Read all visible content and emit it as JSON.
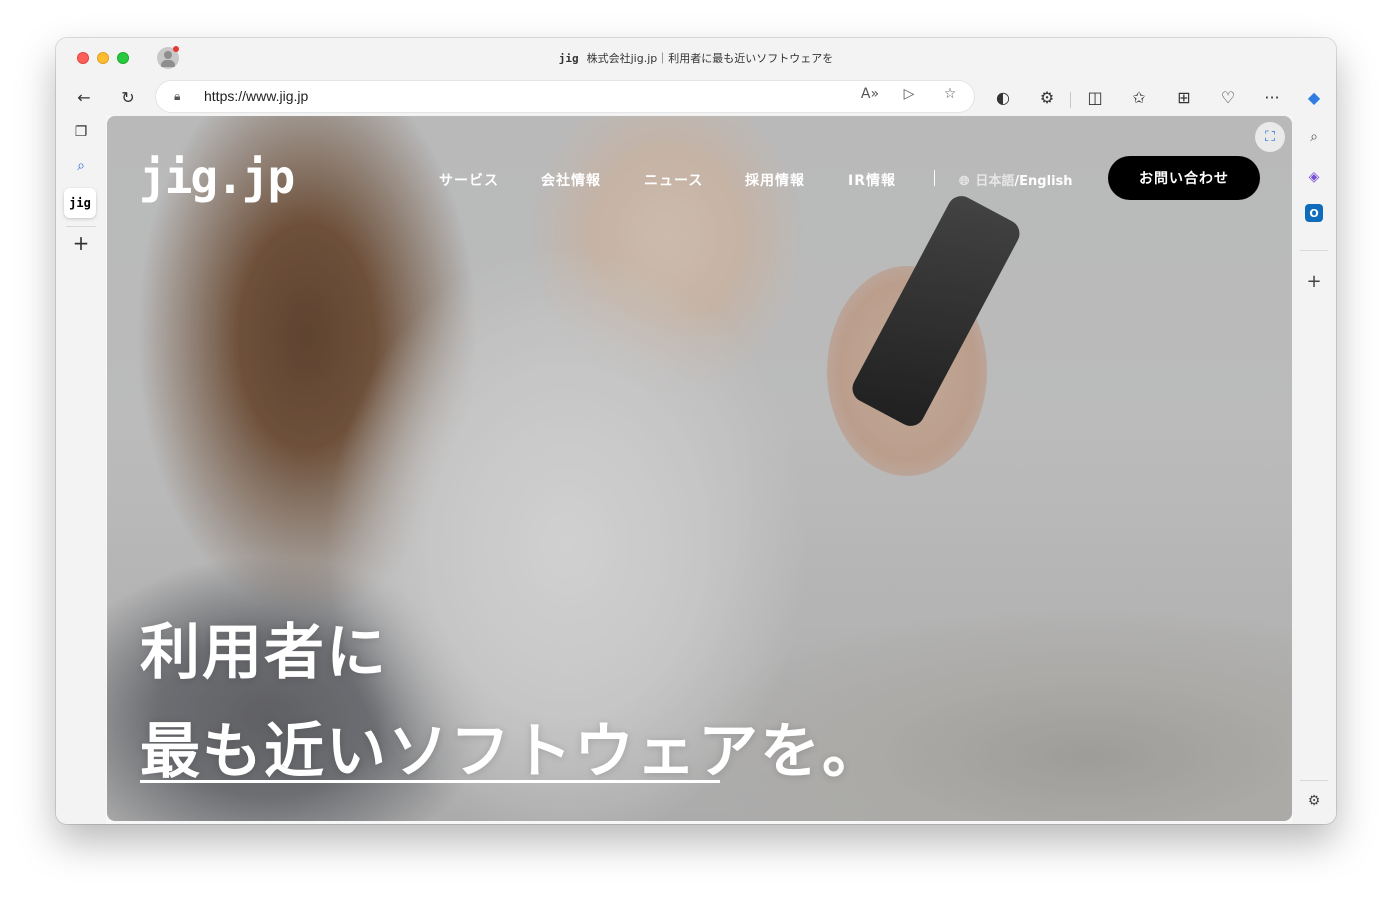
{
  "browser": {
    "tab_title": "株式会社jig.jp｜利用者に最も近いソフトウェアを",
    "tab_favicon": "jig",
    "url": "https://www.jig.jp"
  },
  "toolbar_icons": {
    "back": "←",
    "reload": "↻",
    "read_aloud": "A»",
    "immersive": "▷",
    "favorite": "☆",
    "extension_1": "◐",
    "extensions": "⚙",
    "split": "◫",
    "favorites": "✩",
    "collections": "⊞",
    "health": "♡",
    "more": "···",
    "copilot": "◆"
  },
  "left_sidebar": {
    "tab_actions": "❐",
    "search": "⌕",
    "tab_label": "jig",
    "new_tab": "+"
  },
  "right_sidebar": {
    "search": "⌕",
    "copilot": "◈",
    "outlook": "O",
    "add": "+",
    "settings": "⚙"
  },
  "site": {
    "logo": "jig.jp",
    "nav": [
      "サービス",
      "会社情報",
      "ニュース",
      "採用情報",
      "IR情報"
    ],
    "lang_ja": "日本語",
    "lang_sep": "/",
    "lang_en": "English",
    "contact": "お問い合わせ",
    "hero_line1": "利用者に",
    "hero_line2": "最も近いソフトウェアを。"
  },
  "colors": {
    "contact_button_bg": "#000000",
    "hero_text": "#ffffff",
    "traffic_red": "#ff5f57",
    "traffic_yellow": "#febc2e",
    "traffic_green": "#28c840"
  }
}
